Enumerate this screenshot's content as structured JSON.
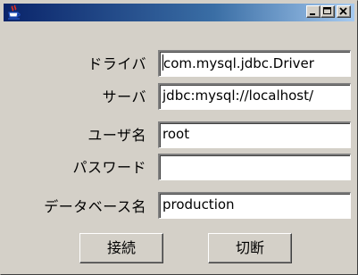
{
  "window": {
    "title": "",
    "icons": {
      "app": "java-coffee-cup-icon",
      "minimize": "minimize-icon",
      "maximize": "maximize-icon",
      "close": "close-icon"
    },
    "colors": {
      "titlebar_start": "#0a246a",
      "titlebar_end": "#a6caf0",
      "face": "#d4d0c8"
    }
  },
  "form": {
    "driver": {
      "label": "ドライバ",
      "value": "com.mysql.jdbc.Driver"
    },
    "server": {
      "label": "サーバ",
      "value": "jdbc:mysql://localhost/"
    },
    "user": {
      "label": "ユーザ名",
      "value": "root"
    },
    "password": {
      "label": "パスワード",
      "value": ""
    },
    "database": {
      "label": "データベース名",
      "value": "production"
    }
  },
  "buttons": {
    "connect": "接続",
    "disconnect": "切断"
  }
}
